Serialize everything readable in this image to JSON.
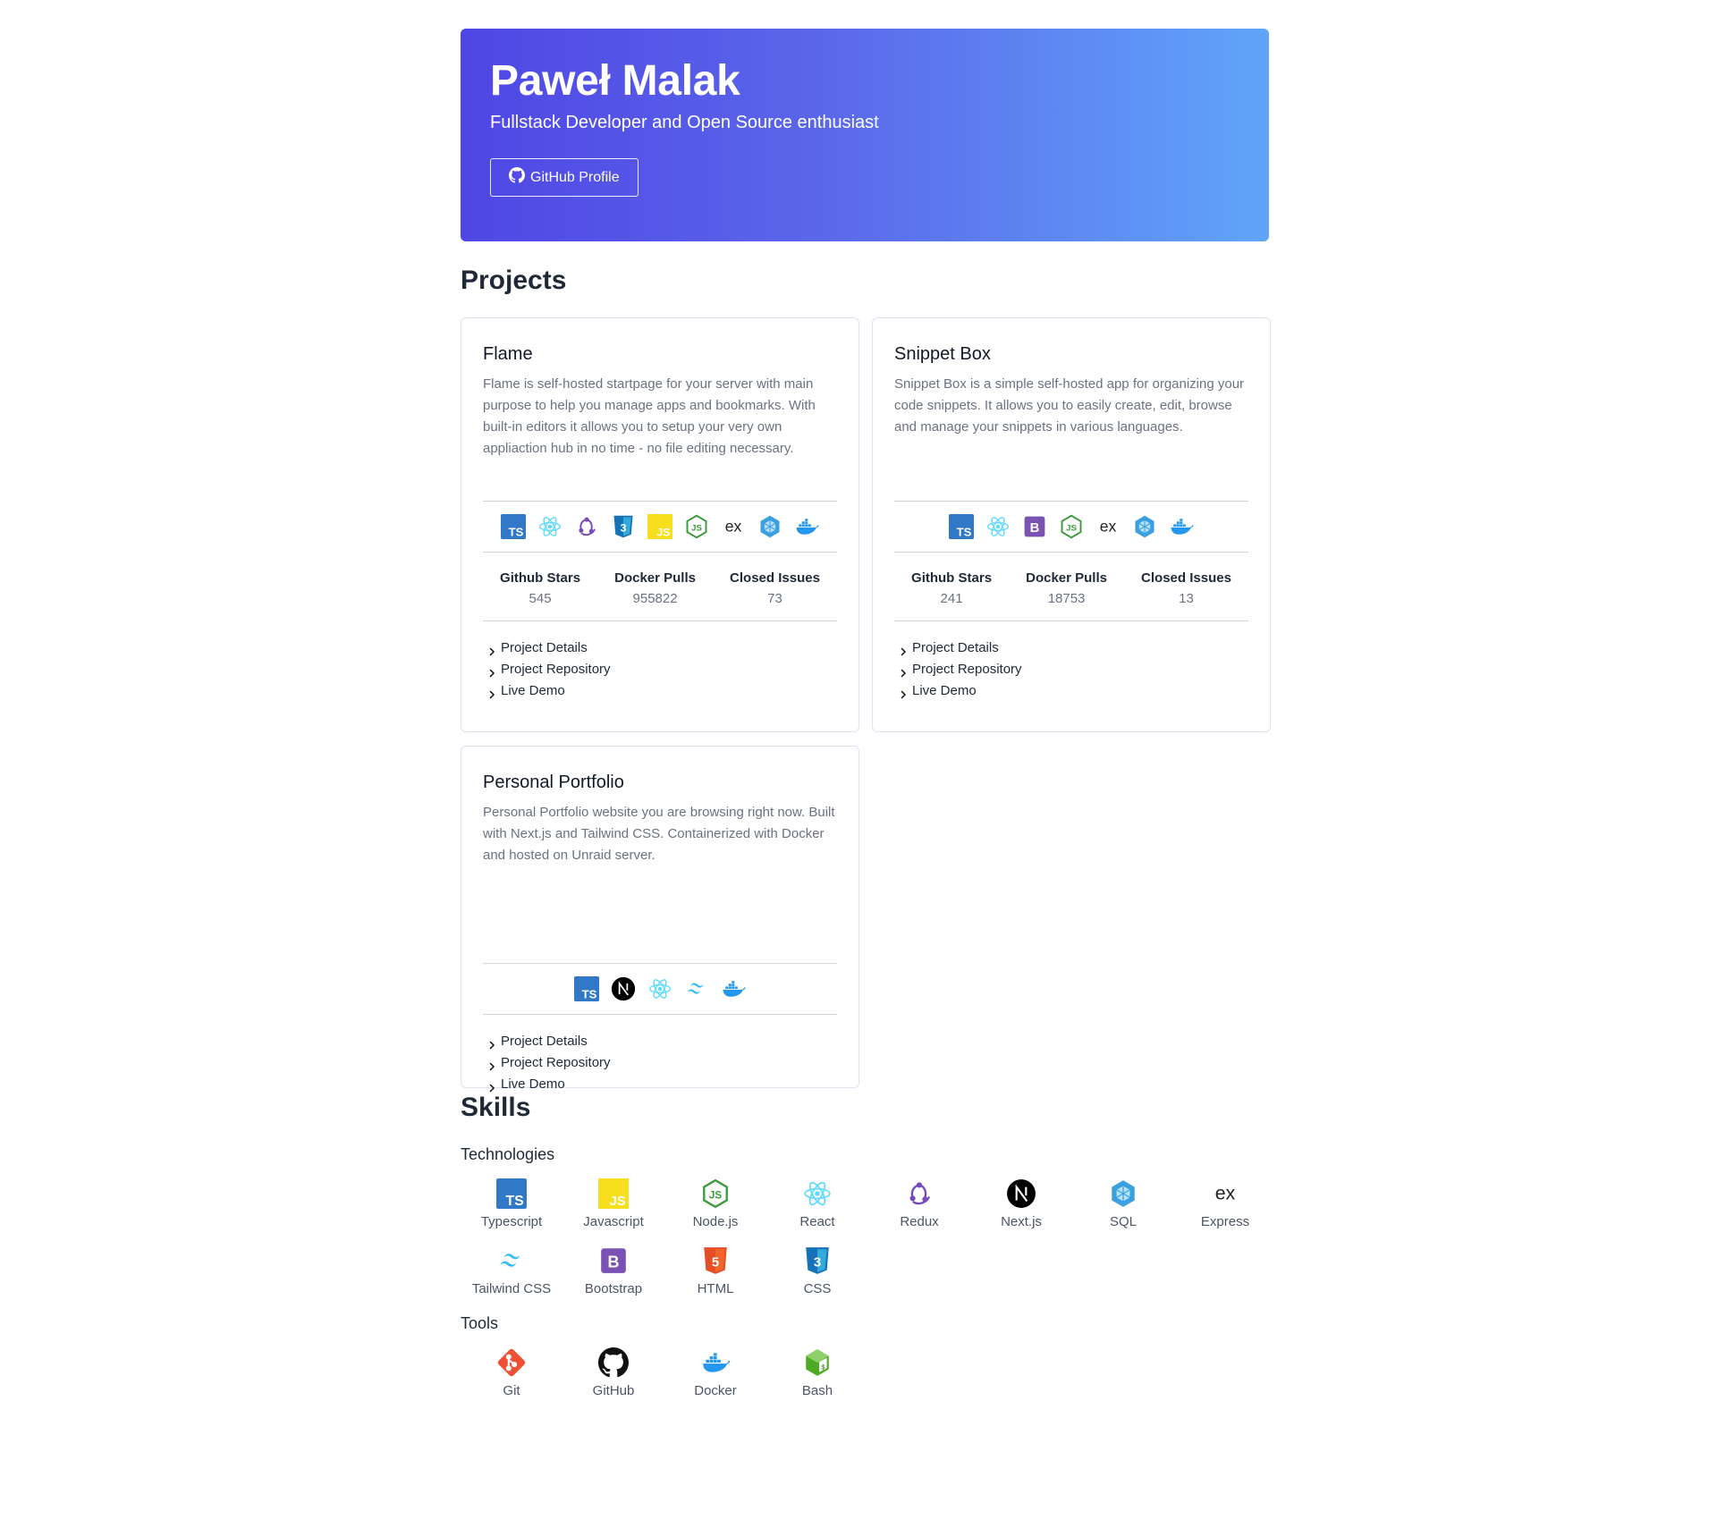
{
  "hero": {
    "name": "Paweł Malak",
    "subtitle": "Fullstack Developer and Open Source enthusiast",
    "github_button": "GitHub Profile"
  },
  "projects": {
    "title": "Projects",
    "cards": [
      {
        "title": "Flame",
        "description": "Flame is self-hosted startpage for your server with main purpose to help you manage apps and bookmarks. With built-in editors it allows you to setup your very own appliaction hub in no time - no file editing necessary.",
        "tech_icons": [
          "typescript-icon",
          "react-icon",
          "redux-icon",
          "css-icon",
          "javascript-icon",
          "nodejs-icon",
          "express-icon",
          "sql-icon",
          "docker-icon"
        ],
        "stats": [
          {
            "label": "Github Stars",
            "value": "545"
          },
          {
            "label": "Docker Pulls",
            "value": "955822"
          },
          {
            "label": "Closed Issues",
            "value": "73"
          }
        ],
        "links": [
          "Project Details",
          "Project Repository",
          "Live Demo"
        ]
      },
      {
        "title": "Snippet Box",
        "description": "Snippet Box is a simple self-hosted app for organizing your code snippets. It allows you to easily create, edit, browse and manage your snippets in various languages.",
        "tech_icons": [
          "typescript-icon",
          "react-icon",
          "bootstrap-icon",
          "nodejs-icon",
          "express-icon",
          "sql-icon",
          "docker-icon"
        ],
        "stats": [
          {
            "label": "Github Stars",
            "value": "241"
          },
          {
            "label": "Docker Pulls",
            "value": "18753"
          },
          {
            "label": "Closed Issues",
            "value": "13"
          }
        ],
        "links": [
          "Project Details",
          "Project Repository",
          "Live Demo"
        ]
      },
      {
        "title": "Personal Portfolio",
        "description": "Personal Portfolio website you are browsing right now. Built with Next.js and Tailwind CSS. Containerized with Docker and hosted on Unraid server.",
        "tech_icons": [
          "typescript-icon",
          "nextjs-icon",
          "react-icon",
          "tailwind-icon",
          "docker-icon"
        ],
        "links": [
          "Project Details",
          "Project Repository",
          "Live Demo"
        ]
      }
    ]
  },
  "skills": {
    "title": "Skills",
    "technologies_title": "Technologies",
    "technologies": [
      {
        "label": "Typescript",
        "icon": "typescript-icon"
      },
      {
        "label": "Javascript",
        "icon": "javascript-icon"
      },
      {
        "label": "Node.js",
        "icon": "nodejs-icon"
      },
      {
        "label": "React",
        "icon": "react-icon"
      },
      {
        "label": "Redux",
        "icon": "redux-icon"
      },
      {
        "label": "Next.js",
        "icon": "nextjs-icon"
      },
      {
        "label": "SQL",
        "icon": "sql-icon"
      },
      {
        "label": "Express",
        "icon": "express-icon"
      },
      {
        "label": "Tailwind CSS",
        "icon": "tailwind-icon"
      },
      {
        "label": "Bootstrap",
        "icon": "bootstrap-icon"
      },
      {
        "label": "HTML",
        "icon": "html-icon"
      },
      {
        "label": "CSS",
        "icon": "css-icon"
      }
    ],
    "tools_title": "Tools",
    "tools": [
      {
        "label": "Git",
        "icon": "git-icon"
      },
      {
        "label": "GitHub",
        "icon": "github-icon"
      },
      {
        "label": "Docker",
        "icon": "docker-icon"
      },
      {
        "label": "Bash",
        "icon": "bash-icon"
      }
    ]
  },
  "colors": {
    "hero_gradient_start": "#4f46e5",
    "hero_gradient_end": "#60a5fa",
    "card_border": "#dbe3ef",
    "muted_text": "#6b7280"
  }
}
